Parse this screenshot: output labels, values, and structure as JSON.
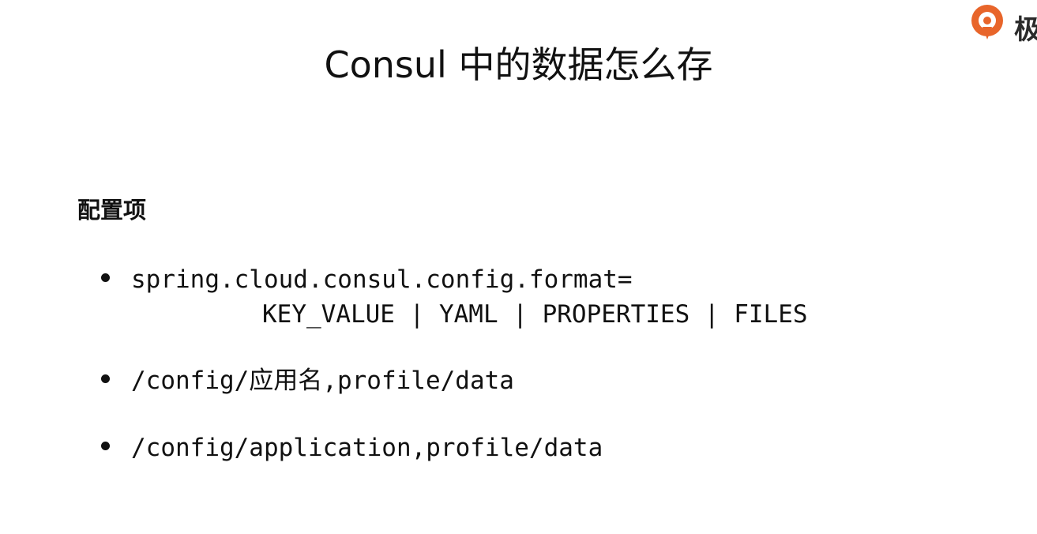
{
  "logo": {
    "icon": "brand-logo-icon",
    "text": "极",
    "color": "#e8652a"
  },
  "title": "Consul 中的数据怎么存",
  "section_heading": "配置项",
  "bullets": [
    {
      "text": "spring.cloud.consul.config.format=",
      "continuation": "KEY_VALUE | YAML | PROPERTIES | FILES"
    },
    {
      "text": "/config/应用名,profile/data"
    },
    {
      "text": "/config/application,profile/data"
    }
  ]
}
